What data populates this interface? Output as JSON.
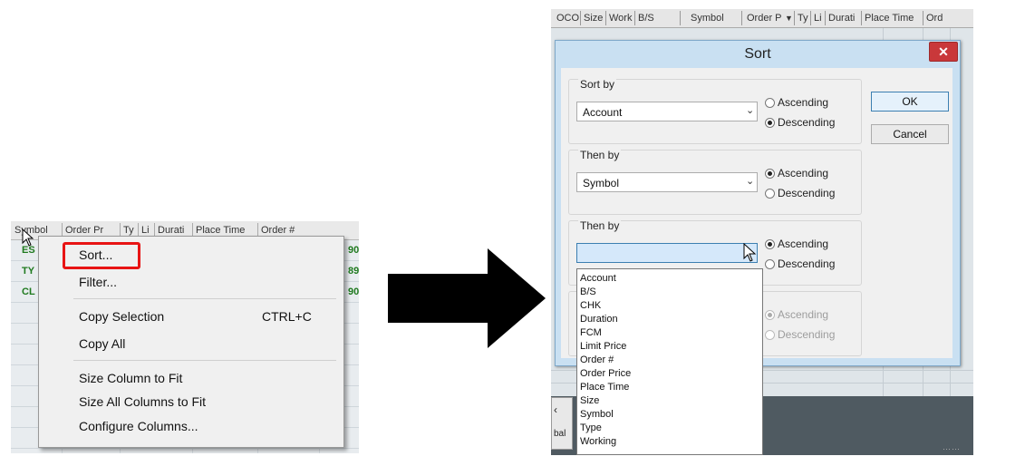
{
  "left_grid": {
    "headers": [
      "Symbol",
      "Order Pr",
      "Ty",
      "Li",
      "Durati",
      "Place Time",
      "Order #"
    ],
    "rows": [
      {
        "symbol": "ES",
        "value": "90"
      },
      {
        "symbol": "TY",
        "value": "89"
      },
      {
        "symbol": "CL",
        "value": "90"
      }
    ]
  },
  "context_menu": {
    "items": [
      {
        "label": "Sort...",
        "shortcut": ""
      },
      {
        "label": "Filter...",
        "shortcut": ""
      },
      {
        "label": "Copy Selection",
        "shortcut": "CTRL+C"
      },
      {
        "label": "Copy All",
        "shortcut": ""
      },
      {
        "label": "Size Column to Fit",
        "shortcut": ""
      },
      {
        "label": "Size All Columns to Fit",
        "shortcut": ""
      },
      {
        "label": "Configure Columns...",
        "shortcut": ""
      }
    ],
    "highlight_color": "#e81414"
  },
  "right_grid": {
    "headers": [
      "OCO",
      "Size",
      "Work",
      "B/S",
      "Symbol",
      "Order P",
      "Ty",
      "Li",
      "Durati",
      "Place Time",
      "Ord"
    ],
    "tab_label": "bal"
  },
  "sort_dialog": {
    "title": "Sort",
    "close_symbol": "✕",
    "groups": [
      {
        "label": "Sort by",
        "value": "Account",
        "ascending_label": "Ascending",
        "descending_label": "Descending",
        "selected": "Descending",
        "enabled": true
      },
      {
        "label": "Then by",
        "value": "Symbol",
        "ascending_label": "Ascending",
        "descending_label": "Descending",
        "selected": "Ascending",
        "enabled": true
      },
      {
        "label": "Then by",
        "value": "",
        "ascending_label": "Ascending",
        "descending_label": "Descending",
        "selected": "Ascending",
        "enabled": true
      },
      {
        "label": "",
        "value": "",
        "ascending_label": "Ascending",
        "descending_label": "Descending",
        "selected": "Ascending",
        "enabled": false
      }
    ],
    "ok_label": "OK",
    "cancel_label": "Cancel",
    "dropdown_options": [
      "Account",
      "B/S",
      "CHK",
      "Duration",
      "FCM",
      "Limit Price",
      "Order #",
      "Order Price",
      "Place Time",
      "Size",
      "Symbol",
      "Type",
      "Working"
    ]
  },
  "colors": {
    "dialog_titlebar": "#c9e0f2",
    "close_button": "#c9383a",
    "grid_green": "#1f7a1f",
    "arrow": "#000000"
  }
}
